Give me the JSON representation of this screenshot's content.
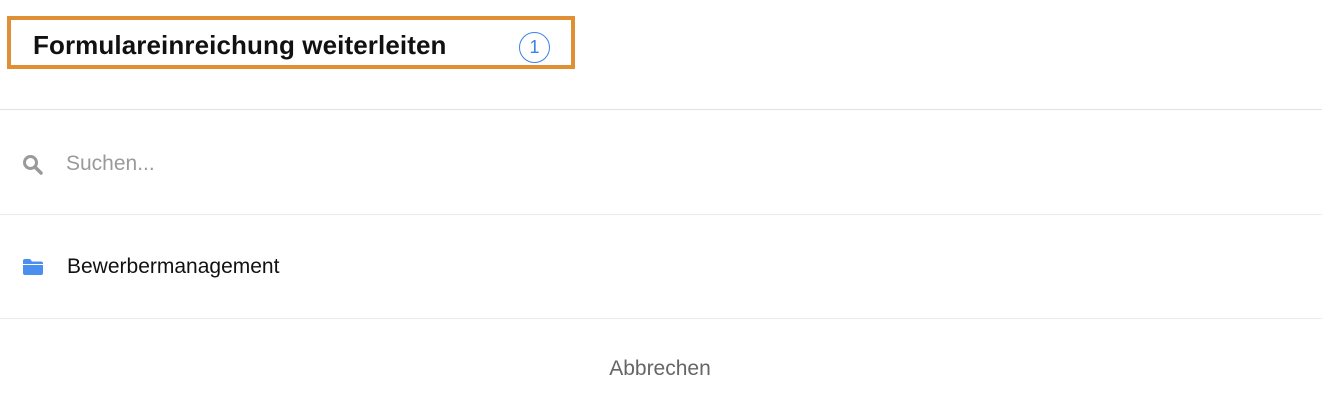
{
  "dialog": {
    "title": "Formulareinreichung weiterleiten",
    "step_badge": "1"
  },
  "search": {
    "placeholder": "Suchen...",
    "value": "",
    "icon": "search-icon"
  },
  "folders": [
    {
      "label": "Bewerbermanagement",
      "icon": "folder-icon"
    }
  ],
  "footer": {
    "cancel_label": "Abbrechen"
  },
  "colors": {
    "highlight_border": "#e08f35",
    "accent_blue": "#3b82e8",
    "folder_blue": "#4a8ff0",
    "search_icon_gray": "#9a9a9a"
  }
}
